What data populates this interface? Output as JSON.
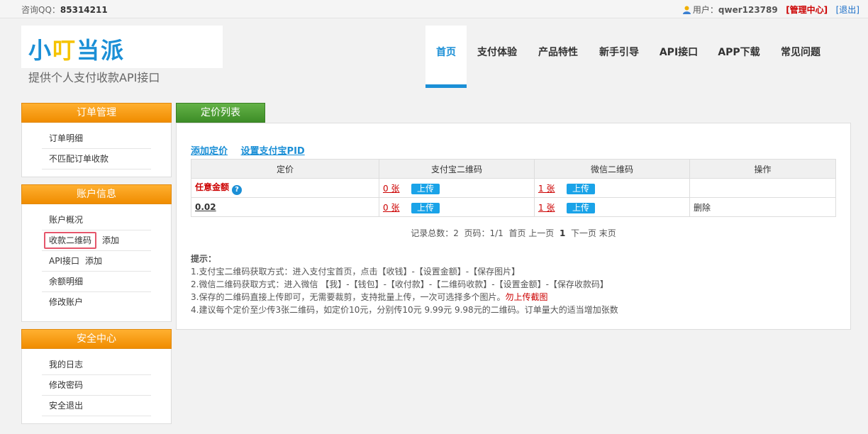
{
  "topbar": {
    "qq_label": "咨询QQ：",
    "qq_number": "85314211",
    "user_label": "用户：",
    "username": "qwer123789",
    "admin_center": "[管理中心]",
    "logout": "[退出]"
  },
  "brand": {
    "logo_text_1": "小",
    "logo_text_2": "叮",
    "logo_text_3": "当派",
    "slogan": "提供个人支付收款API接口"
  },
  "nav": {
    "items": [
      "首页",
      "支付体验",
      "产品特性",
      "新手引导",
      "API接口",
      "APP下载",
      "常见问题"
    ],
    "active_index": 0
  },
  "sidebar": {
    "orders": {
      "title": "订单管理",
      "items": [
        "订单明细",
        "不匹配订单收款"
      ]
    },
    "account": {
      "title": "账户信息",
      "items": [
        "账户概况",
        "收款二维码",
        "API接口",
        "余额明细",
        "修改账户"
      ],
      "extra_add": "添加"
    },
    "security": {
      "title": "安全中心",
      "items": [
        "我的日志",
        "修改密码",
        "安全退出"
      ]
    }
  },
  "main": {
    "tab_title": "定价列表",
    "actions": [
      "添加定价",
      "设置支付宝PID"
    ],
    "table": {
      "headers": [
        "定价",
        "支付宝二维码",
        "微信二维码",
        "操作"
      ],
      "rows": [
        {
          "price": "任意金额",
          "alipay_count": "0 张",
          "wechat_count": "1 张",
          "upload": "上传",
          "op": ""
        },
        {
          "price": "0.02",
          "alipay_count": "0 张",
          "wechat_count": "1 张",
          "upload": "上传",
          "op": "删除"
        }
      ]
    },
    "pager": {
      "total_label": "记录总数：",
      "total": "2",
      "page_label": "页码：",
      "page": "1/1",
      "first": "首页",
      "prev": "上一页",
      "current": "1",
      "next": "下一页",
      "last": "末页"
    },
    "tips": {
      "title": "提示：",
      "lines": [
        "1.支付宝二维码获取方式：进入支付宝首页，点击【收钱】-【设置金额】-【保存图片】",
        "2.微信二维码获取方式：进入微信 【我】-【钱包】-【收付款】-【二维码收款】-【设置金额】-【保存收款码】",
        "3.保存的二维码直接上传即可，无需要裁剪，支持批量上传，一次可选择多个图片。",
        "4.建议每个定价至少传3张二维码，如定价10元，分别传10元 9.99元 9.98元的二维码。订单量大的适当增加张数"
      ],
      "warning": "勿上传截图"
    }
  },
  "colors": {
    "accent_blue": "#1b8fd6",
    "orange_header": "#f08c00",
    "green_tab": "#3d8d27",
    "red": "#cc0000",
    "highlight_border": "#e5566b"
  }
}
